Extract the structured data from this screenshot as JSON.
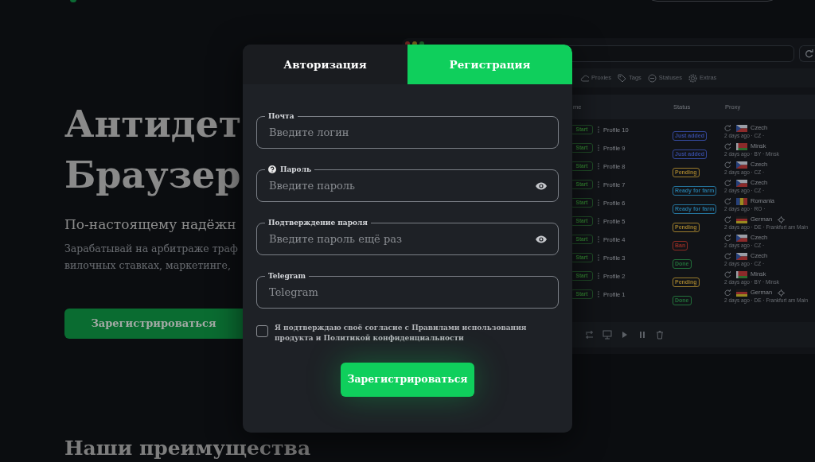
{
  "landing": {
    "hero_title": [
      "Антидет",
      "Браузер"
    ],
    "subtitle": "По-настоящему надёжн",
    "description": [
      "Зарабатывай на арбитраже траф",
      "вилочных ставках, маркетинге,"
    ],
    "cta_button": "Зарегистрироваться",
    "section_title": "Наши преимущества"
  },
  "app_preview": {
    "nav_tabs": [
      {
        "label": "Proxies",
        "kind": "cloud"
      },
      {
        "label": "Tags",
        "kind": "tag"
      },
      {
        "label": "Statuses",
        "kind": "status"
      },
      {
        "label": "Extras",
        "kind": "gear"
      }
    ],
    "columns": [
      "me",
      "Status",
      "Proxy"
    ],
    "rows": [
      {
        "action": "Start",
        "name": "Profile 10",
        "status": "Just added",
        "color": "#34489a",
        "proxy": "Czech",
        "kind": "cz",
        "geo": false,
        "detail": "2 days ago · CZ ·"
      },
      {
        "action": "Start",
        "name": "Profile 9",
        "status": "Just added",
        "color": "#34489a",
        "proxy": "Minsk",
        "kind": "by",
        "geo": false,
        "detail": "2 days ago · BY · Minsk"
      },
      {
        "action": "Start",
        "name": "Profile 8",
        "status": "Pending",
        "color": "#9a7b2c",
        "proxy": "Czech",
        "kind": "cz",
        "geo": false,
        "detail": "2 days ago · CZ ·"
      },
      {
        "action": "Start",
        "name": "Profile 7",
        "status": "Ready for farm",
        "color": "#24739b",
        "proxy": "Czech",
        "kind": "cz",
        "geo": false,
        "detail": "2 days ago · CZ ·"
      },
      {
        "action": "Start",
        "name": "Profile 6",
        "status": "Ready for farm",
        "color": "#24739b",
        "proxy": "Romania",
        "kind": "ro",
        "geo": false,
        "detail": "2 days ago · RO ·"
      },
      {
        "action": "Start",
        "name": "Profile 5",
        "status": "Pending",
        "color": "#9a7b2c",
        "proxy": "German",
        "kind": "de",
        "geo": true,
        "detail": "2 days ago · DE · Frankfurt am Main"
      },
      {
        "action": "Start",
        "name": "Profile 4",
        "status": "Ban",
        "color": "#8f2c24",
        "proxy": "Czech",
        "kind": "cz",
        "geo": false,
        "detail": "2 days ago · CZ ·"
      },
      {
        "action": "Start",
        "name": "Profile 3",
        "status": "Done",
        "color": "#22703a",
        "proxy": "Czech",
        "kind": "cz",
        "geo": false,
        "detail": "2 days ago · CZ ·"
      },
      {
        "action": "Start",
        "name": "Profile 2",
        "status": "Pending",
        "color": "#9a7b2c",
        "proxy": "Minsk",
        "kind": "by",
        "geo": false,
        "detail": "2 days ago · BY · Minsk"
      },
      {
        "action": "Start",
        "name": "Profile 1",
        "status": "Done",
        "color": "#22703a",
        "proxy": "German",
        "kind": "de",
        "geo": true,
        "detail": "2 days ago · DE · Frankfurt am Main"
      }
    ]
  },
  "modal": {
    "tabs": [
      {
        "label": "Авторизация",
        "selected": false
      },
      {
        "label": "Регистрация",
        "selected": true
      }
    ],
    "fields": [
      {
        "label": "Почта",
        "placeholder": "Введите логин",
        "help": false,
        "reveal": false
      },
      {
        "label": "Пароль",
        "placeholder": "Введите пароль",
        "help": true,
        "reveal": true
      },
      {
        "label": "Подтверждение пароля",
        "placeholder": "Введите пароль ещё раз",
        "help": false,
        "reveal": true
      },
      {
        "label": "Telegram",
        "placeholder": "Telegram",
        "help": false,
        "reveal": false
      }
    ],
    "consent": {
      "text": "Я подтверждаю своё согласие с Правилами использования продукта и Политикой конфиденциальности",
      "checked": false
    },
    "submit": "Зарегистрироваться"
  }
}
